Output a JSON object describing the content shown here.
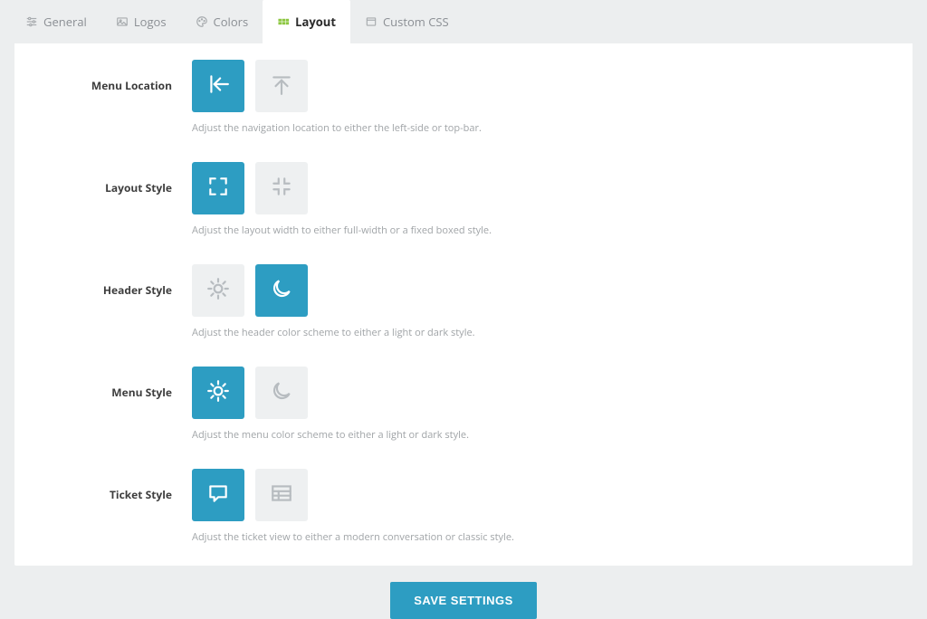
{
  "tabs": {
    "general": "General",
    "logos": "Logos",
    "colors": "Colors",
    "layout": "Layout",
    "custom_css": "Custom CSS"
  },
  "sections": {
    "menu_location": {
      "label": "Menu Location",
      "hint": "Adjust the navigation location to either the left-side or top-bar.",
      "selected": "left"
    },
    "layout_style": {
      "label": "Layout Style",
      "hint": "Adjust the layout width to either full-width or a fixed boxed style.",
      "selected": "full"
    },
    "header_style": {
      "label": "Header Style",
      "hint": "Adjust the header color scheme to either a light or dark style.",
      "selected": "dark"
    },
    "menu_style": {
      "label": "Menu Style",
      "hint": "Adjust the menu color scheme to either a light or dark style.",
      "selected": "light"
    },
    "ticket_style": {
      "label": "Ticket Style",
      "hint": "Adjust the ticket view to either a modern conversation or classic style.",
      "selected": "conversation"
    }
  },
  "actions": {
    "save": "SAVE SETTINGS"
  }
}
